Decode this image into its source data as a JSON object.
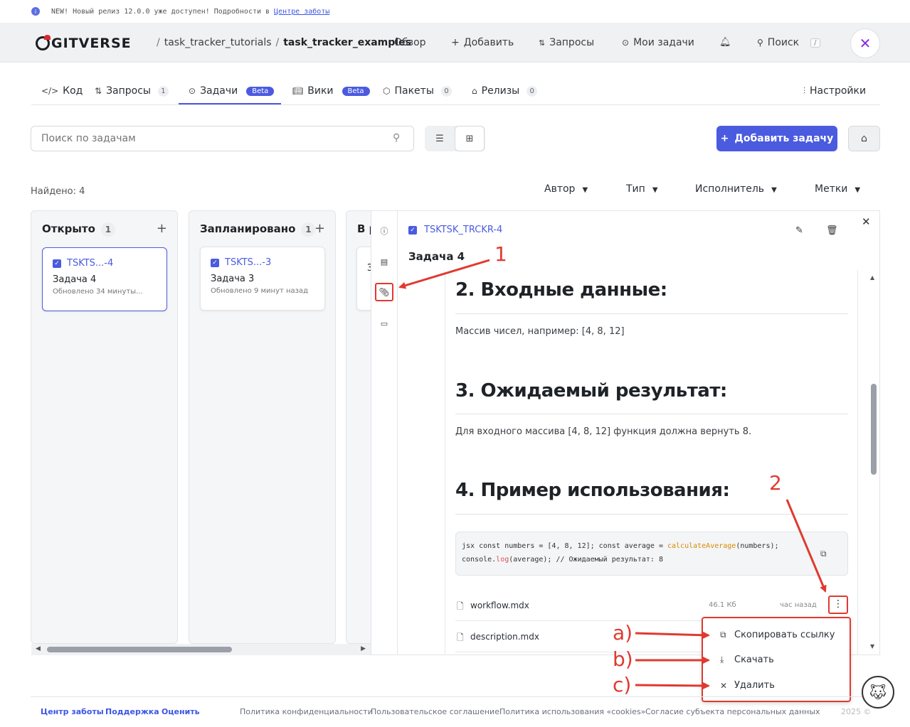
{
  "banner": {
    "text": "NEW! Новый релиз 12.0.0 уже доступен! Подробности в",
    "link": "Центре заботы"
  },
  "header": {
    "logo": "GITVERSE",
    "owner": "task_tracker_tutorials",
    "repo": "task_tracker_examples",
    "nav": [
      "Обзор",
      "Добавить",
      "Запросы",
      "Мои задачи",
      "Поиск"
    ],
    "search_shortcut": "/"
  },
  "tabs": [
    {
      "label": "Код"
    },
    {
      "label": "Запросы",
      "count": "1"
    },
    {
      "label": "Задачи",
      "badge": "Beta"
    },
    {
      "label": "Вики",
      "badge": "Beta"
    },
    {
      "label": "Пакеты",
      "count": "0"
    },
    {
      "label": "Релизы",
      "count": "0"
    }
  ],
  "settings_label": "Настройки",
  "search": {
    "placeholder": "Поиск по задачам"
  },
  "add_task_label": "Добавить задачу",
  "found": "Найдено: 4",
  "filters": [
    "Автор",
    "Тип",
    "Исполнитель",
    "Метки"
  ],
  "columns": [
    {
      "title": "Открыто",
      "count": "1",
      "card": {
        "id": "TSKTS...-4",
        "title": "Задача 4",
        "updated": "Обновлено 34 минуты..."
      }
    },
    {
      "title": "Запланировано",
      "count": "1",
      "card": {
        "id": "TSKTS...-3",
        "title": "Задача 3",
        "updated": "Обновлено 9 минут назад"
      }
    },
    {
      "title": "В р",
      "card_fragment": "З"
    }
  ],
  "panel": {
    "task_id": "TSKTSK_TRCKR-4",
    "title": "Задача 4",
    "sections": [
      {
        "heading": "2. Входные данные:",
        "text": "Массив чисел, например: [4, 8, 12]"
      },
      {
        "heading": "3. Ожидаемый результат:",
        "text": "Для входного массива [4, 8, 12] функция должна вернуть 8."
      },
      {
        "heading": "4. Пример использования:"
      }
    ],
    "code": {
      "line1_pre": "jsx const numbers = [4, 8, 12]; const average = ",
      "line1_fn": "calculateAverage",
      "line1_post": "(numbers);",
      "line2_pre": "console.",
      "line2_kw": "log",
      "line2_post": "(average); // Ожидаемый результат: 8"
    },
    "files": [
      {
        "name": "workflow.mdx",
        "size": "46.1 Кб",
        "time": "час назад"
      },
      {
        "name": "description.mdx"
      }
    ]
  },
  "menu": {
    "items": [
      "Скопировать ссылку",
      "Скачать",
      "Удалить"
    ]
  },
  "annotations": {
    "one": "1",
    "two": "2",
    "a": "a)",
    "b": "b)",
    "c": "c)"
  },
  "footer": {
    "links_bold": [
      "Центр заботы",
      "Поддержка",
      "Оценить"
    ],
    "links": [
      "Политика конфиденциальности",
      "Пользовательское соглашение",
      "Политика использования «cookies»",
      "Согласие субъекта персональных данных"
    ],
    "copyright": "2025 ©"
  },
  "colors": {
    "accent": "#4a5be0",
    "annotation": "#e03a2f"
  }
}
